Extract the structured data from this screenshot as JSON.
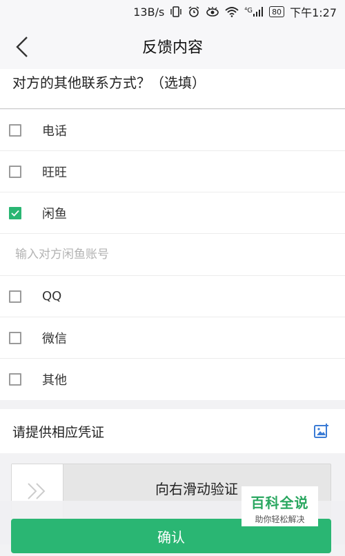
{
  "status_bar": {
    "speed": "13B/s",
    "network": "⁴G",
    "battery": "80",
    "time": "下午1:27"
  },
  "header": {
    "title": "反馈内容"
  },
  "contact_section": {
    "title": "对方的其他联系方式？（选填）",
    "options": [
      {
        "label": "电话",
        "checked": false
      },
      {
        "label": "旺旺",
        "checked": false
      },
      {
        "label": "闲鱼",
        "checked": true
      },
      {
        "label": "QQ",
        "checked": false
      },
      {
        "label": "微信",
        "checked": false
      },
      {
        "label": "其他",
        "checked": false
      }
    ],
    "xianyu_input_placeholder": "输入对方闲鱼账号",
    "xianyu_input_value": ""
  },
  "evidence": {
    "label": "请提供相应凭证"
  },
  "slider": {
    "text": "向右滑动验证"
  },
  "confirm": {
    "label": "确认"
  },
  "watermark": {
    "title": "百科全说",
    "subtitle": "助你轻松解决"
  },
  "colors": {
    "accent": "#2ab673",
    "icon_blue": "#3a7bd5"
  }
}
